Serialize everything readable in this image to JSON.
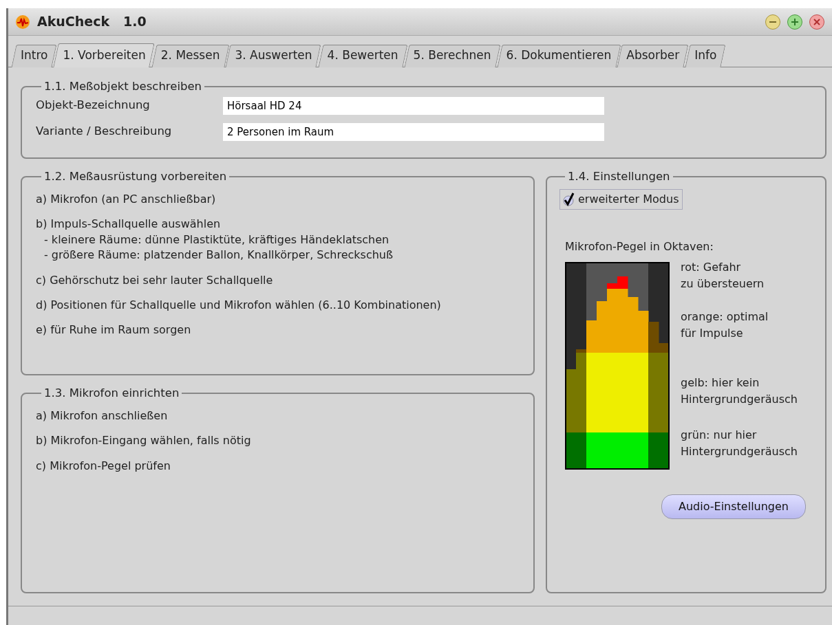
{
  "window": {
    "title": "AkuCheck   1.0"
  },
  "tabs": [
    {
      "label": "Intro",
      "selected": false
    },
    {
      "label": "1. Vorbereiten",
      "selected": true
    },
    {
      "label": "2. Messen",
      "selected": false
    },
    {
      "label": "3. Auswerten",
      "selected": false
    },
    {
      "label": "4. Bewerten",
      "selected": false
    },
    {
      "label": "5. Berechnen",
      "selected": false
    },
    {
      "label": "6. Dokumentieren",
      "selected": false
    },
    {
      "label": "Absorber",
      "selected": false
    },
    {
      "label": "Info",
      "selected": false
    }
  ],
  "object_section": {
    "title": "1.1. Meßobjekt beschreiben",
    "fields": [
      {
        "label": "Objekt-Bezeichnung",
        "value": "Hörsaal HD 24"
      },
      {
        "label": "Variante / Beschreibung",
        "value": "2 Personen im Raum"
      }
    ]
  },
  "equipment_section": {
    "title": "1.2. Meßausrüstung vorbereiten",
    "items": [
      {
        "text": "a) Mikrofon (an PC anschließbar)"
      },
      {
        "text": "b) Impuls-Schallquelle auswählen",
        "details": [
          "- kleinere Räume: dünne Plastiktüte, kräftiges Händeklatschen",
          "- größere Räume: platzender Ballon, Knallkörper, Schreckschuß"
        ]
      },
      {
        "text": "c) Gehörschutz bei sehr lauter Schallquelle"
      },
      {
        "text": "d) Positionen für Schallquelle und Mikrofon wählen (6..10 Kombinationen)"
      },
      {
        "text": "e) für Ruhe im Raum sorgen"
      }
    ]
  },
  "microphone_section": {
    "title": "1.3. Mikrofon einrichten",
    "items": [
      {
        "text": "a) Mikrofon anschließen"
      },
      {
        "text": "b) Mikrofon-Eingang wählen, falls nötig"
      },
      {
        "text": "c) Mikrofon-Pegel prüfen"
      }
    ]
  },
  "settings_section": {
    "title": "1.4. Einstellungen",
    "checkbox": {
      "label": "erweiterter Modus",
      "checked": true
    },
    "meter_title": "Mikrofon-Pegel in Oktaven:",
    "legend": [
      {
        "lines": [
          "rot: Gefahr",
          "zu übersteuern"
        ]
      },
      {
        "lines": [
          "orange: optimal",
          "für Impulse"
        ]
      },
      {
        "lines": [
          "gelb: hier kein",
          "Hintergrundgeräusch"
        ]
      },
      {
        "lines": [
          "grün: nur hier",
          "Hintergrundgeräusch"
        ]
      }
    ],
    "button": "Audio-Einstellungen"
  }
}
